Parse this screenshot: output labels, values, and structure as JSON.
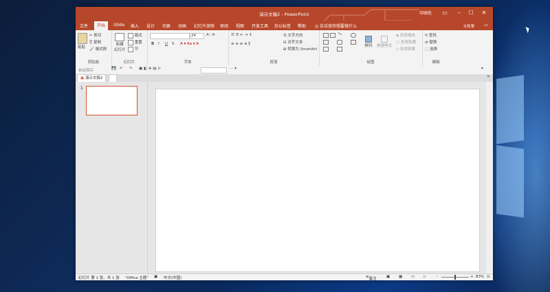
{
  "window": {
    "title": "演示文稿2 - PowerPoint",
    "user": "中国先",
    "share": "共享"
  },
  "tabs": [
    "文件",
    "开始",
    "iSlide",
    "插入",
    "设计",
    "切换",
    "动画",
    "幻灯片放映",
    "审阅",
    "视图",
    "开发工具",
    "办公标签",
    "帮助"
  ],
  "active_tab": "开始",
  "tell_me": "告诉我你想要做什么",
  "ribbon": {
    "clipboard": {
      "paste": "粘贴",
      "cut": "剪切",
      "copy": "复制",
      "format_painter": "格式刷",
      "label": "剪贴板"
    },
    "slides": {
      "new_slide": "新建",
      "new_slide2": "幻灯片",
      "layout": "版式",
      "reset": "重置",
      "section": "节",
      "label": "幻灯片"
    },
    "font": {
      "size": "24",
      "bold": "B",
      "italic": "I",
      "underline": "U",
      "strike": "S",
      "label": "字体"
    },
    "paragraph": {
      "text_direction": "文字方向",
      "align_text": "对齐文本",
      "smartart": "转换为 SmartArt",
      "label": "段落"
    },
    "drawing": {
      "arrange": "排列",
      "quick_styles": "快速样式",
      "fill": "形状填充",
      "outline": "形状轮廓",
      "effects": "形状效果",
      "label": "绘图"
    },
    "editing": {
      "find": "查找",
      "replace": "替换",
      "select": "选择",
      "label": "编辑"
    }
  },
  "qat": {
    "autosave": "自动保存"
  },
  "doc_tab": "演示文稿2",
  "slide_number": "1",
  "status": {
    "slide_info": "幻灯片 第 1 张，共 1 张",
    "theme": "\"Office 主题\"",
    "language": "中文(中国)",
    "notes": "备注",
    "zoom": "83%"
  }
}
